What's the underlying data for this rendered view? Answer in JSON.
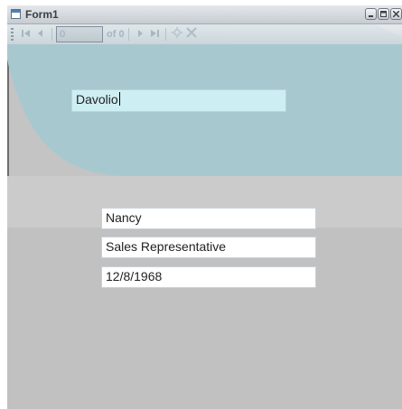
{
  "window": {
    "title": "Form1"
  },
  "navigator": {
    "position_value": "0",
    "count_label": "of 0",
    "icons": [
      "move-first-icon",
      "move-previous-icon",
      "move-next-icon",
      "move-last-icon",
      "add-new-icon",
      "delete-icon"
    ]
  },
  "fields": {
    "last_name": "Davolio",
    "first_name": "Nancy",
    "title": "Sales Representative",
    "birth_date": "12/8/1968"
  },
  "colors": {
    "background_shape": "#a8c8cf",
    "window_body": "#c4c4c4",
    "selected_field": "#cdeef3"
  }
}
